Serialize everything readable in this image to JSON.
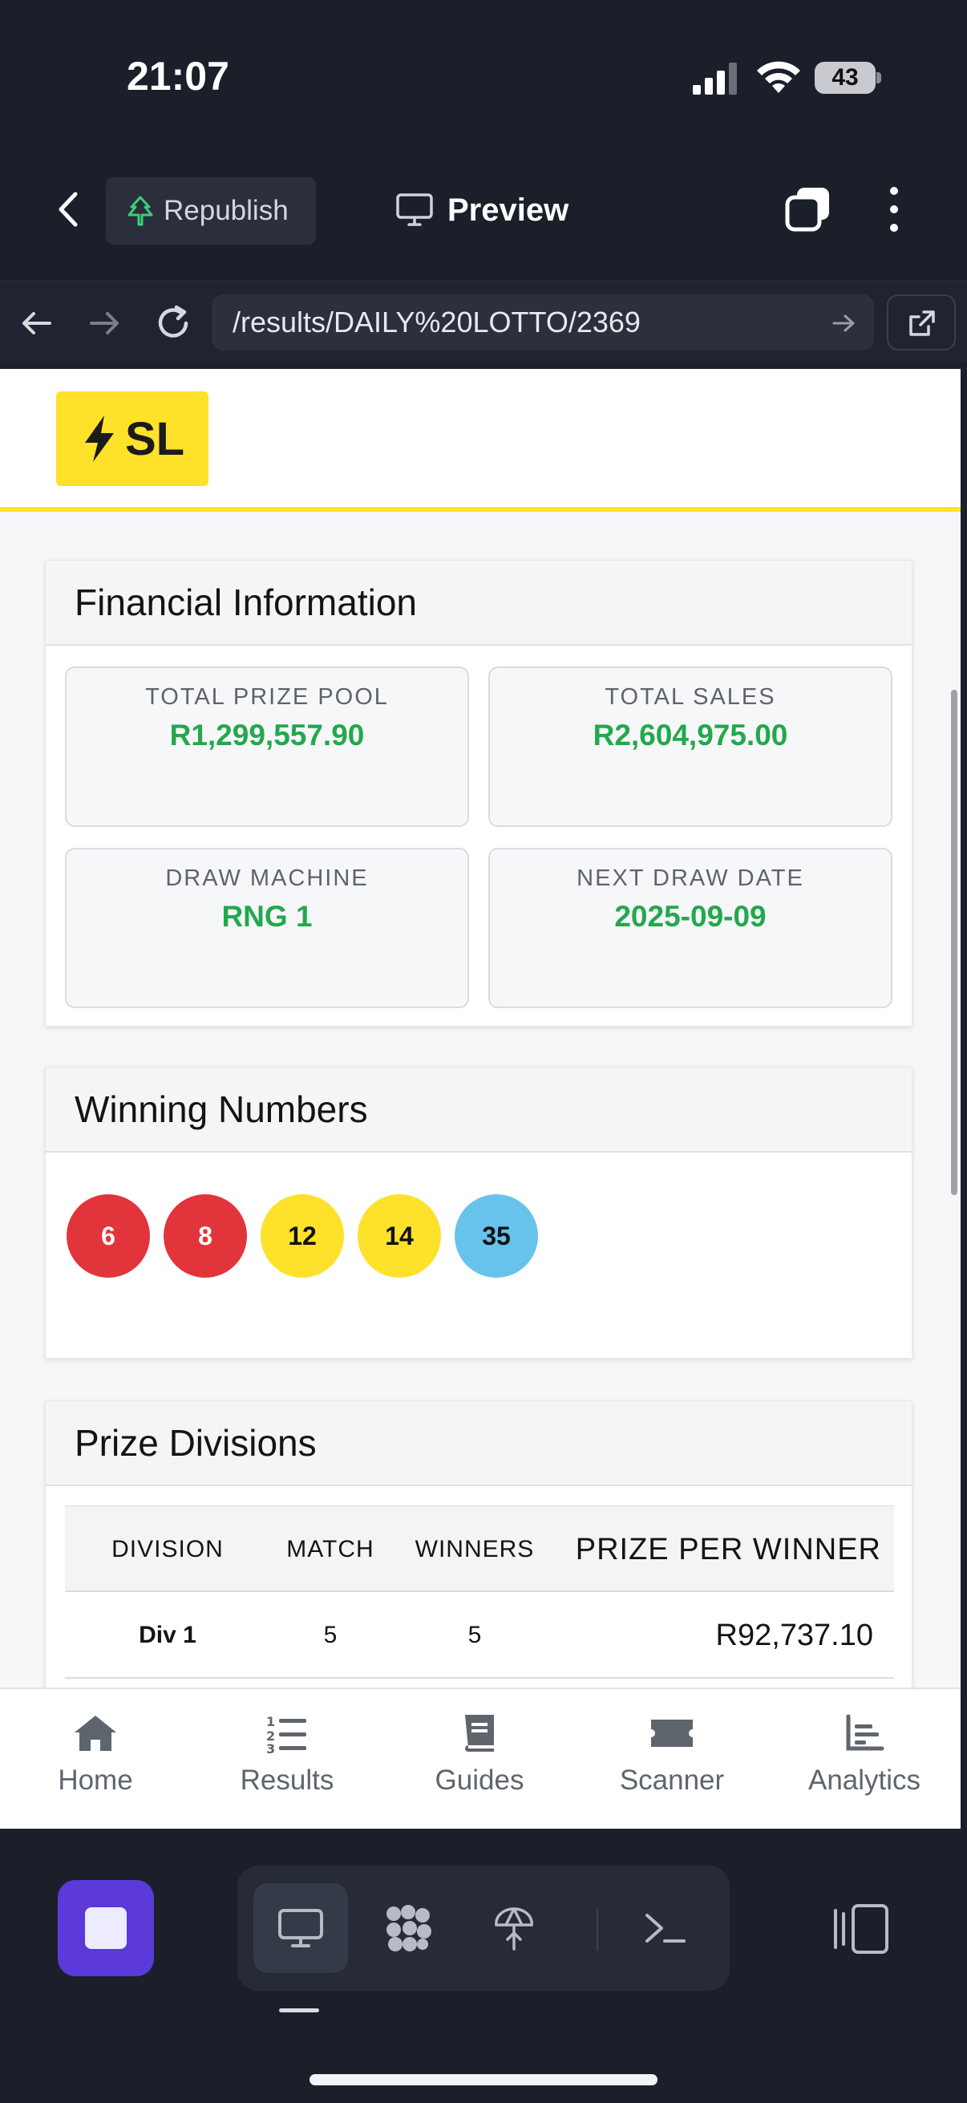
{
  "status_bar": {
    "time": "21:07",
    "battery": "43"
  },
  "top_bar": {
    "republish_label": "Republish",
    "preview_label": "Preview"
  },
  "url_bar": {
    "url": "/results/DAILY%20LOTTO/2369"
  },
  "site": {
    "logo_text": "SL"
  },
  "financial": {
    "title": "Financial Information",
    "tiles": [
      {
        "label": "TOTAL PRIZE POOL",
        "value": "R1,299,557.90"
      },
      {
        "label": "TOTAL SALES",
        "value": "R2,604,975.00"
      },
      {
        "label": "DRAW MACHINE",
        "value": "RNG 1"
      },
      {
        "label": "NEXT DRAW DATE",
        "value": "2025-09-09"
      }
    ]
  },
  "winning": {
    "title": "Winning Numbers",
    "balls": [
      {
        "number": "6",
        "color": "#e2353b"
      },
      {
        "number": "8",
        "color": "#e2353b"
      },
      {
        "number": "12",
        "color": "#fde12b"
      },
      {
        "number": "14",
        "color": "#fde12b"
      },
      {
        "number": "35",
        "color": "#67c3ec"
      }
    ]
  },
  "prizes": {
    "title": "Prize Divisions",
    "columns": [
      "DIVISION",
      "MATCH",
      "WINNERS",
      "PRIZE PER WINNER"
    ],
    "rows": [
      {
        "division": "Div 1",
        "match": "5",
        "winners": "5",
        "prize": "R92,737.10"
      }
    ]
  },
  "tabs": [
    {
      "label": "Home",
      "icon": "home-icon"
    },
    {
      "label": "Results",
      "icon": "numbered-list-icon"
    },
    {
      "label": "Guides",
      "icon": "book-icon"
    },
    {
      "label": "Scanner",
      "icon": "ticket-icon"
    },
    {
      "label": "Analytics",
      "icon": "bar-chart-icon"
    }
  ],
  "colors": {
    "accent_yellow": "#fde12b",
    "money_green": "#23a84c",
    "dock_purple": "#5b3ad9"
  }
}
